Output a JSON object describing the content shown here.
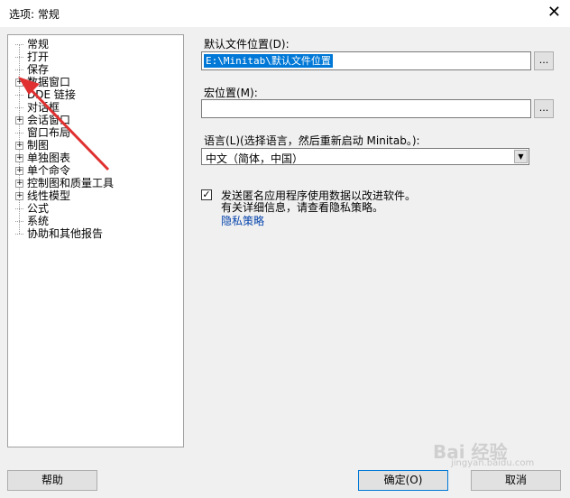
{
  "window": {
    "title": "选项: 常规",
    "close_label": "✕"
  },
  "tree": {
    "items": [
      {
        "label": "常规",
        "expandable": false
      },
      {
        "label": "打开",
        "expandable": false
      },
      {
        "label": "保存",
        "expandable": false
      },
      {
        "label": "数据窗口",
        "expandable": true
      },
      {
        "label": "DDE 链接",
        "expandable": false
      },
      {
        "label": "对话框",
        "expandable": false
      },
      {
        "label": "会话窗口",
        "expandable": true
      },
      {
        "label": "窗口布局",
        "expandable": false
      },
      {
        "label": "制图",
        "expandable": true
      },
      {
        "label": "单独图表",
        "expandable": true
      },
      {
        "label": "单个命令",
        "expandable": true
      },
      {
        "label": "控制图和质量工具",
        "expandable": true
      },
      {
        "label": "线性模型",
        "expandable": true
      },
      {
        "label": "公式",
        "expandable": false
      },
      {
        "label": "系统",
        "expandable": false
      },
      {
        "label": "协助和其他报告",
        "expandable": false
      }
    ],
    "expander_glyph": "+"
  },
  "default_location": {
    "label": "默认文件位置(D):",
    "value": "E:\\Minitab\\默认文件位置",
    "browse_label": "..."
  },
  "macro_location": {
    "label": "宏位置(M):",
    "value": "",
    "browse_label": "..."
  },
  "language": {
    "label": "语言(L)(选择语言，然后重新启动 Minitab。):",
    "selected": "中文（简体，中国）",
    "arrow_glyph": "▼"
  },
  "telemetry": {
    "checked": true,
    "check_glyph": "✓",
    "line1": "发送匿名应用程序使用数据以改进软件。",
    "line2": "有关详细信息，请查看隐私策略。",
    "privacy_link": "隐私策略"
  },
  "buttons": {
    "help": "帮助",
    "ok": "确定(O)",
    "cancel": "取消"
  },
  "watermark": {
    "text": "Bai 经验",
    "sub": "jingyan.baidu.com"
  },
  "colors": {
    "selection": "#0078d7",
    "link": "#0645ad",
    "annotation_arrow": "#e03030"
  }
}
